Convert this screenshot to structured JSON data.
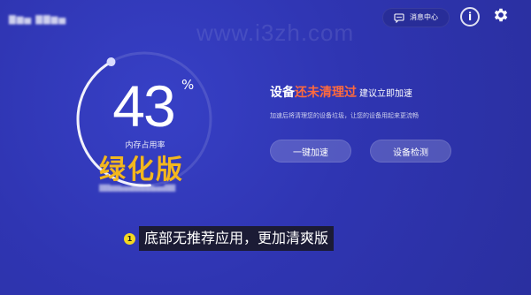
{
  "app": {
    "blurred_title": "▇▆▅ ▇▇▆▅"
  },
  "watermark": {
    "text": "www.i3zh.com"
  },
  "header": {
    "message_center_label": "消息中心",
    "info_label": "i"
  },
  "memory": {
    "percent_value": "43",
    "percent_sign": "%",
    "caption": "内存占用率",
    "ring_fraction": 0.43
  },
  "overlay": {
    "green_stamp": "绿化版",
    "blurred_line": "▇▇▆▆▅▅▇▇▆▆▅▅▇▇",
    "bullet": "1",
    "caption": "底部无推荐应用，更加清爽版"
  },
  "status": {
    "prefix": "设备",
    "highlight": "还未清理过",
    "suffix": "建议立即加速",
    "description": "加速后将清理您的设备垃圾，让您的设备用起来更流畅"
  },
  "actions": {
    "speedup_label": "一键加速",
    "detect_label": "设备检测"
  },
  "colors": {
    "background": "#2f35b2",
    "highlight": "#ff6a3d",
    "stamp": "#f3b71f",
    "bullet": "#f5d820"
  }
}
